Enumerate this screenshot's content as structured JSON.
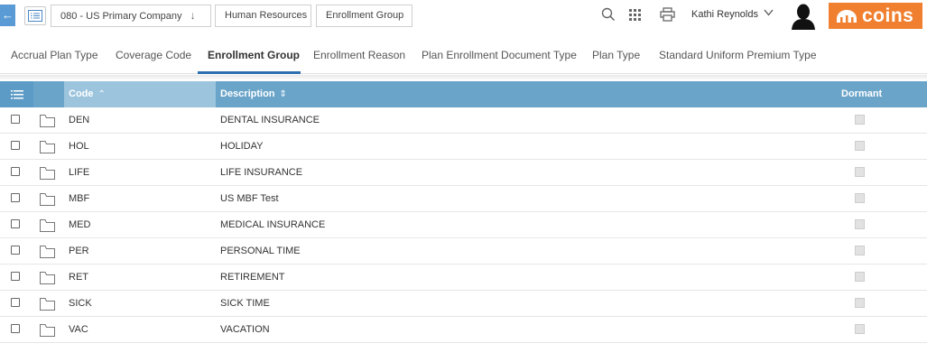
{
  "breadcrumb": {
    "company": "080 - US Primary Company",
    "module": "Human Resources",
    "page": "Enrollment Group"
  },
  "user": {
    "name": "Kathi Reynolds"
  },
  "logo": {
    "text": "coins",
    "color": "#f08030"
  },
  "icons": [
    "back-arrow-icon",
    "list-icon",
    "search-icon",
    "apps-grid-icon",
    "printer-icon",
    "chevron-down-icon",
    "user-avatar-icon",
    "folder-icon"
  ],
  "tabs": [
    {
      "label": "Accrual Plan Type"
    },
    {
      "label": "Coverage Code"
    },
    {
      "label": "Enrollment Group",
      "active": true
    },
    {
      "label": "Enrollment Reason"
    },
    {
      "label": "Plan Enrollment Document Type"
    },
    {
      "label": "Plan Type"
    },
    {
      "label": "Standard Uniform Premium Type"
    }
  ],
  "grid": {
    "header_color": "#6aa4c9",
    "columns": {
      "code": "Code",
      "description": "Description",
      "dormant": "Dormant"
    },
    "rows": [
      {
        "code": "DEN",
        "description": "DENTAL INSURANCE",
        "dormant": false
      },
      {
        "code": "HOL",
        "description": "HOLIDAY",
        "dormant": false
      },
      {
        "code": "LIFE",
        "description": "LIFE INSURANCE",
        "dormant": false
      },
      {
        "code": "MBF",
        "description": "US MBF Test",
        "dormant": false
      },
      {
        "code": "MED",
        "description": "MEDICAL INSURANCE",
        "dormant": false
      },
      {
        "code": "PER",
        "description": "PERSONAL TIME",
        "dormant": false
      },
      {
        "code": "RET",
        "description": "RETIREMENT",
        "dormant": false
      },
      {
        "code": "SICK",
        "description": "SICK TIME",
        "dormant": false
      },
      {
        "code": "VAC",
        "description": "VACATION",
        "dormant": false
      }
    ]
  }
}
